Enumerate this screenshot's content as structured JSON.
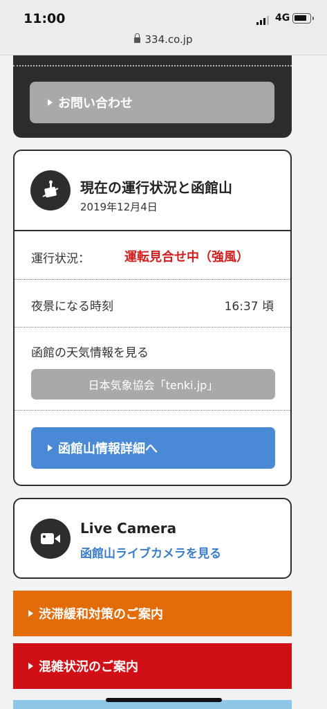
{
  "status_bar": {
    "time": "11:00",
    "network": "4G",
    "url": "334.co.jp"
  },
  "contact": {
    "label": "お問い合わせ"
  },
  "status_card": {
    "title": "現在の運行状況と函館山",
    "date": "2019年12月4日",
    "operation_label": "運行状況：",
    "operation_value": "運転見合せ中（強風）",
    "night_label": "夜景になる時刻",
    "night_value": "16:37 頃",
    "weather_label": "函館の天気情報を見る",
    "weather_button": "日本気象協会「tenki.jp」",
    "detail_button": "函館山情報詳細へ"
  },
  "camera_card": {
    "title": "Live Camera",
    "link": "函館山ライブカメラを見る"
  },
  "bars": {
    "traffic": "渋滞緩和対策のご案内",
    "crowd": "混雑状況のご案内"
  },
  "colors": {
    "accent_blue": "#4a89d6",
    "status_red": "#d21e1e",
    "orange": "#e26b0a",
    "red": "#d10f17",
    "dark": "#2d2d2d"
  },
  "icons": [
    "lock-icon",
    "ropeway-icon",
    "camera-icon",
    "triangle-right-icon"
  ]
}
